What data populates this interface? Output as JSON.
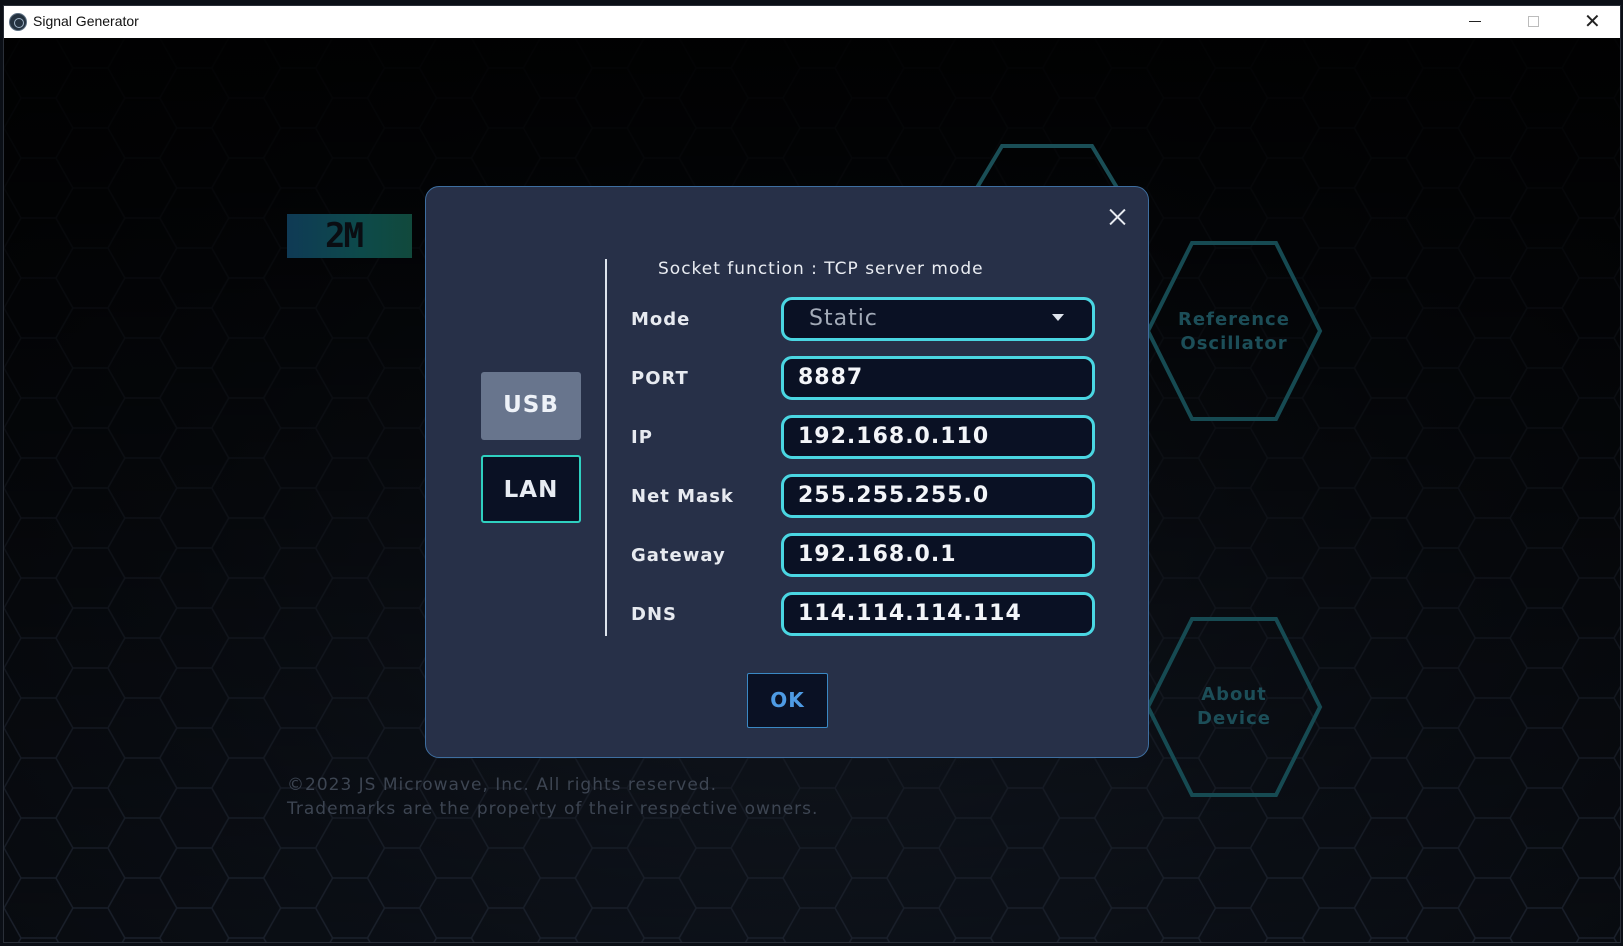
{
  "window": {
    "title": "Signal Generator",
    "icon": "app-logo-icon",
    "controls": [
      "minimize-icon",
      "maximize-icon",
      "close-icon"
    ]
  },
  "background": {
    "logo_text": "2M",
    "nav": [
      {
        "label_line1": "Reference",
        "label_line2": "Oscillator"
      },
      {
        "label_line1": "About",
        "label_line2": "Device"
      }
    ],
    "copyright_line1": "©2023 JS Microwave, Inc. All rights reserved.",
    "copyright_line2": "Trademarks are the property of their respective owners."
  },
  "dialog": {
    "close_icon": "close-icon",
    "interfaces": {
      "usb": "USB",
      "lan": "LAN",
      "selected": "LAN"
    },
    "section_title": "Socket function : TCP server mode",
    "fields": [
      {
        "label": "Mode",
        "value": "Static"
      },
      {
        "label": "PORT",
        "value": "8887"
      },
      {
        "label": "IP",
        "value": "192.168.0.110"
      },
      {
        "label": "Net Mask",
        "value": "255.255.255.0"
      },
      {
        "label": "Gateway",
        "value": "192.168.0.1"
      },
      {
        "label": "DNS",
        "value": "114.114.114.114"
      }
    ],
    "ok_label": "OK"
  },
  "colors": {
    "dialog_bg": "#273048",
    "input_border": "#4ad6e2",
    "lan_border": "#2fd0c0",
    "ok_text": "#4e9be4"
  }
}
